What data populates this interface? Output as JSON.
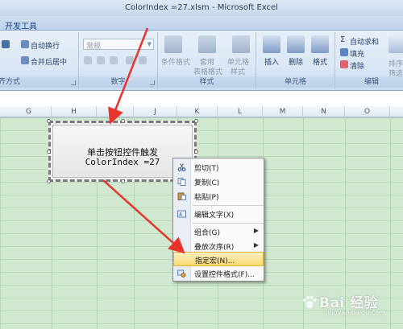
{
  "window": {
    "title": "ColorIndex =27.xlsm - Microsoft Excel"
  },
  "ribbon": {
    "tab_developer": "开发工具",
    "alignment": {
      "wrap_text": "自动换行",
      "merge_center": "合并后居中",
      "label": "齐方式"
    },
    "number": {
      "format_value": "常规",
      "label": "数字"
    },
    "styles": {
      "conditional": "条件格式",
      "table_format": "套用",
      "table_format2": "表格格式",
      "cell_style": "单元格",
      "cell_style2": "样式",
      "label": "样式"
    },
    "cells": {
      "insert": "插入",
      "delete": "删除",
      "format": "格式",
      "label": "单元格"
    },
    "editing": {
      "autosum": "自动求和",
      "fill": "填充",
      "clear": "清除",
      "sort": "排序",
      "filter": "筛选",
      "label": "编辑"
    }
  },
  "sheet": {
    "columns": [
      "G",
      "H",
      "I",
      "J",
      "K",
      "L",
      "M",
      "N",
      "O"
    ]
  },
  "form_button": {
    "line1": "单击按钮控件触发",
    "line2": "ColorIndex =27"
  },
  "context_menu": {
    "items": [
      {
        "label": "剪切(T)",
        "icon": "scissors-icon"
      },
      {
        "label": "复制(C)",
        "icon": "copy-icon"
      },
      {
        "label": "粘贴(P)",
        "icon": "paste-icon"
      },
      {
        "label": "编辑文字(X)",
        "icon": "edit-text-icon"
      },
      {
        "label": "组合(G)",
        "icon": "",
        "submenu": true
      },
      {
        "label": "叠放次序(R)",
        "icon": "",
        "submenu": true
      },
      {
        "label": "指定宏(N)...",
        "icon": "",
        "highlighted": true
      },
      {
        "label": "设置控件格式(F)...",
        "icon": "format-control-icon"
      }
    ]
  },
  "watermark": {
    "brand": "Bai 经验",
    "url": "jingyan.baidu.com"
  },
  "colors": {
    "annotation_arrow": "#e8342a",
    "menu_highlight": "#fbd96e",
    "grid_bg": "#cfe8cf"
  }
}
